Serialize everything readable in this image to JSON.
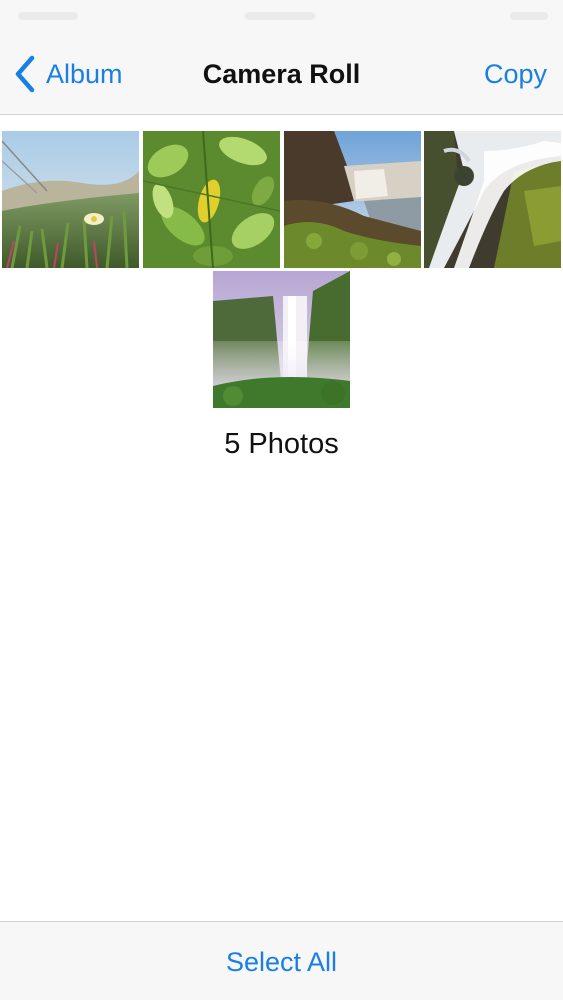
{
  "nav": {
    "back_label": "Album",
    "back_icon": "chevron-left-icon",
    "title": "Camera Roll",
    "copy_label": "Copy"
  },
  "photos": [
    {
      "name": "photo-flowers-meadow"
    },
    {
      "name": "photo-green-leaves"
    },
    {
      "name": "photo-waterfall-cliff"
    },
    {
      "name": "photo-cascade-rocks"
    },
    {
      "name": "photo-misty-waterfall"
    }
  ],
  "photo_count": "5 Photos",
  "toolbar": {
    "select_all_label": "Select All"
  },
  "colors": {
    "accent": "#1a7fe5",
    "bar_background": "#f7f7f8"
  }
}
